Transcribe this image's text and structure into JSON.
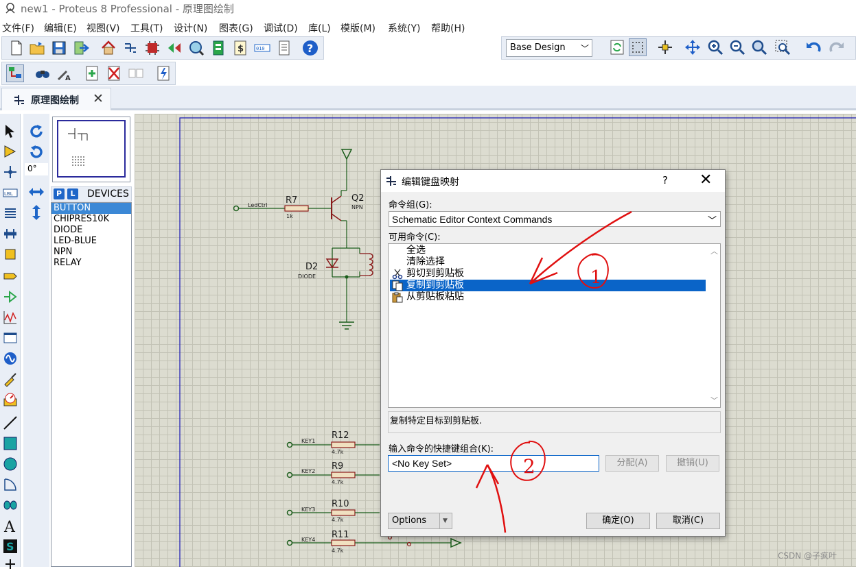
{
  "window": {
    "title": "new1 - Proteus 8 Professional - 原理图绘制"
  },
  "menu": [
    "文件(F)",
    "编辑(E)",
    "视图(V)",
    "工具(T)",
    "设计(N)",
    "图表(G)",
    "调试(D)",
    "库(L)",
    "模版(M)",
    "系统(Y)",
    "帮助(H)"
  ],
  "toolbar": {
    "design_select": "Base Design",
    "main_icons": [
      "new-file-icon",
      "open-folder-icon",
      "save-icon",
      "import-icon",
      "home-icon",
      "schematic-icon",
      "pcb-icon",
      "3d-visualizer-icon",
      "gerber-viewer-icon",
      "bom-icon",
      "cost-icon",
      "binary-icon",
      "notes-icon",
      "help-icon"
    ],
    "view_icons": [
      "refresh-icon",
      "grid-icon",
      "origin-icon",
      "pan-icon",
      "zoom-in-icon",
      "zoom-out-icon",
      "zoom-all-icon",
      "zoom-area-icon",
      "undo-icon",
      "redo-icon"
    ],
    "second_icons": [
      "schematic-tab-icon",
      "search-icon",
      "property-tool-icon",
      "new-sheet-icon",
      "delete-sheet-icon",
      "goto-sheet-icon",
      "spice-icon"
    ]
  },
  "tab": {
    "label": "原理图绘制"
  },
  "rotation": {
    "value": "0°"
  },
  "devices": {
    "header": "DEVICES",
    "items": [
      "BUTTON",
      "CHIPRES10K",
      "DIODE",
      "LED-BLUE",
      "NPN",
      "RELAY"
    ],
    "selected_index": 0
  },
  "schematic": {
    "labels": {
      "ledctrl": "LedCtrl",
      "r7": "R7",
      "r7_val": "1k",
      "q2": "Q2",
      "q2_type": "NPN",
      "d2": "D2",
      "d2_type": "DIODE",
      "key1": "KEY1",
      "r12": "R12",
      "r12_val": "4.7k",
      "key2": "KEY2",
      "r9": "R9",
      "r9_val": "4.7k",
      "key3": "KEY3",
      "r10": "R10",
      "r10_val": "4.7k",
      "key4": "KEY4",
      "r11": "R11",
      "r11_val": "4.7k"
    }
  },
  "dialog": {
    "title": "编辑键盘映射",
    "help": "?",
    "close": "✕",
    "command_group_label": "命令组(G):",
    "command_group_value": "Schematic Editor Context Commands",
    "available_label": "可用命令(C):",
    "commands": [
      {
        "label": "全选",
        "icon": ""
      },
      {
        "label": "清除选择",
        "icon": ""
      },
      {
        "label": "剪切到剪贴板",
        "icon": "scissors-icon"
      },
      {
        "label": "复制到剪贴板",
        "icon": "copy-icon"
      },
      {
        "label": "从剪贴板粘贴",
        "icon": "paste-icon"
      }
    ],
    "selected_command_index": 3,
    "description": "复制特定目标到剪贴板.",
    "key_label": "输入命令的快捷键组合(K):",
    "key_value": "<No Key Set>",
    "assign_button": "分配(A)",
    "revoke_button": "撤销(U)",
    "options_button": "Options",
    "ok_button": "确定(O)",
    "cancel_button": "取消(C)"
  },
  "annotations": {
    "mark1": "1",
    "mark2": "2"
  },
  "watermark": "CSDN @子疯叶"
}
